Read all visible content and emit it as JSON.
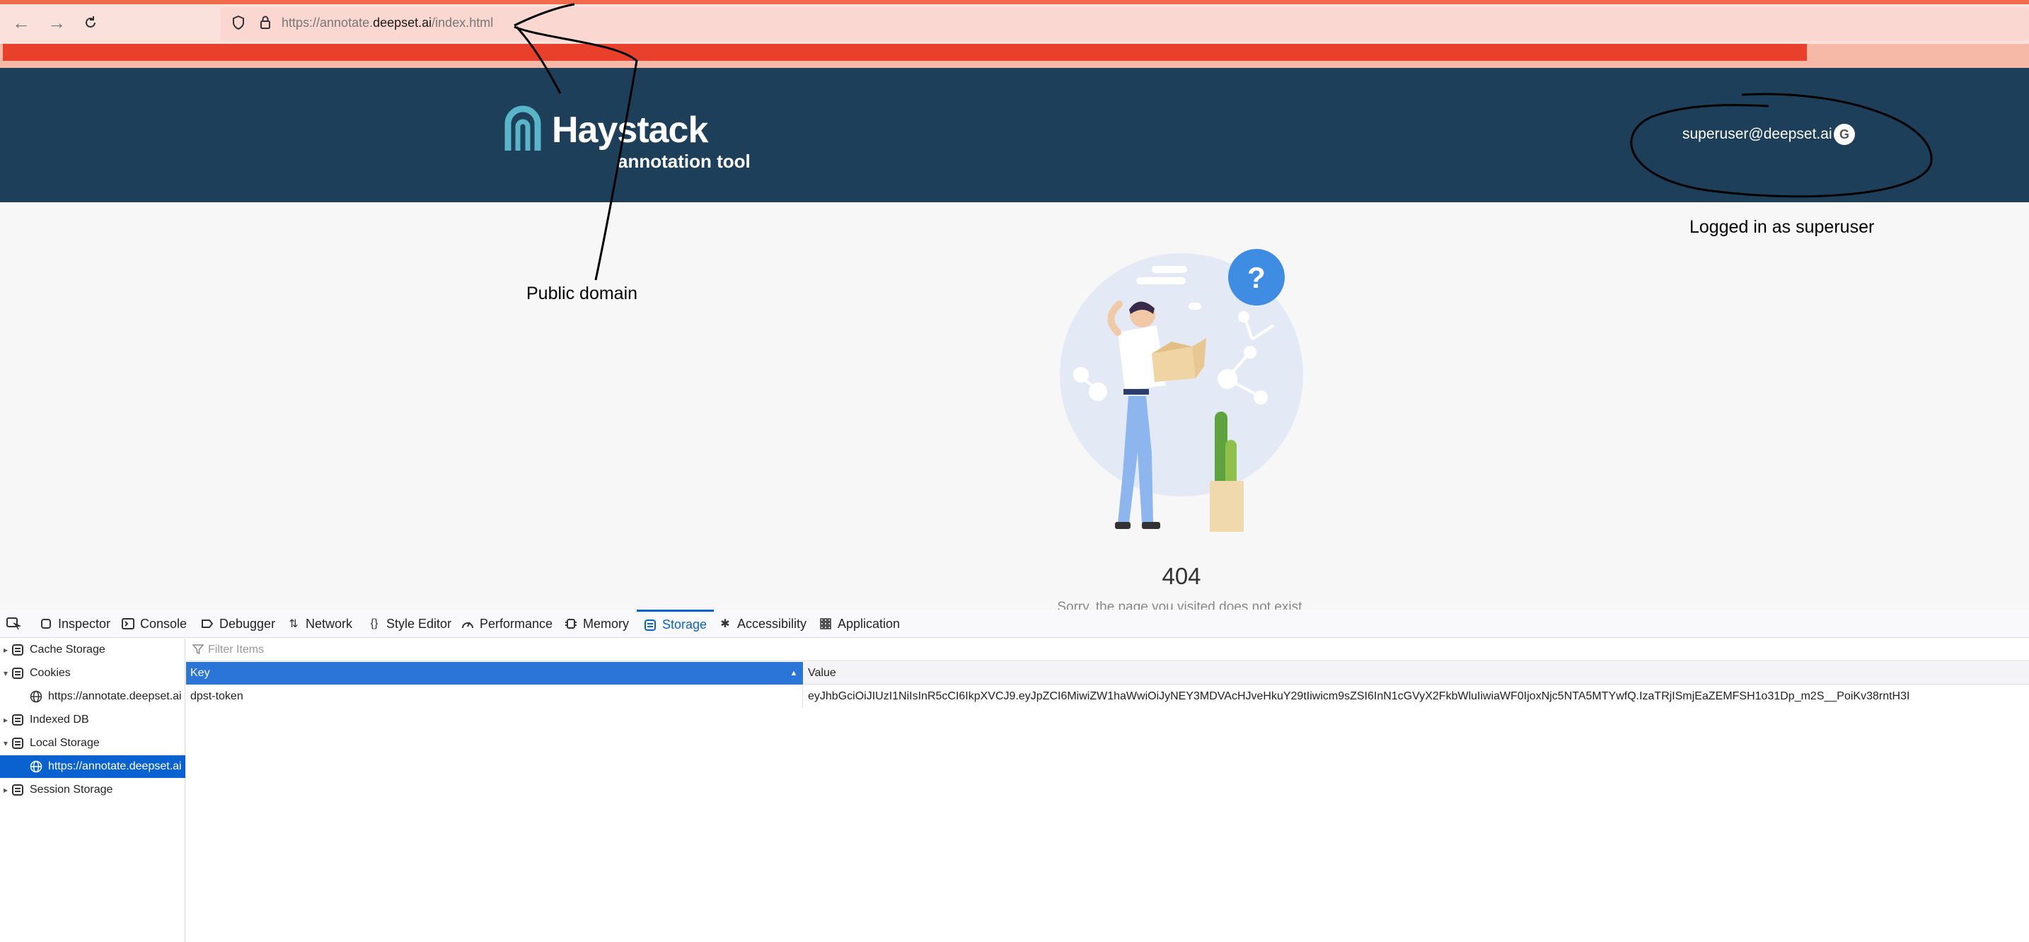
{
  "browser": {
    "url_prefix": "https://annotate.",
    "url_domain": "deepset.ai",
    "url_path": "/index.html"
  },
  "app": {
    "logo_title": "Haystack",
    "logo_subtitle": "annotation tool",
    "user_email": "superuser@deepset.ai",
    "google_icon_letter": "G",
    "brand_color": "#1d3f5a"
  },
  "content": {
    "error_code": "404",
    "error_message": "Sorry, the page you visited does not exist."
  },
  "annotations": {
    "public_domain": "Public domain",
    "logged_in": "Logged in as superuser"
  },
  "devtools": {
    "tabs": [
      {
        "label": "Inspector",
        "icon": "inspector-icon"
      },
      {
        "label": "Console",
        "icon": "console-icon"
      },
      {
        "label": "Debugger",
        "icon": "debugger-icon"
      },
      {
        "label": "Network",
        "icon": "network-icon"
      },
      {
        "label": "Style Editor",
        "icon": "style-editor-icon"
      },
      {
        "label": "Performance",
        "icon": "performance-icon"
      },
      {
        "label": "Memory",
        "icon": "memory-icon"
      },
      {
        "label": "Storage",
        "icon": "storage-icon",
        "active": true
      },
      {
        "label": "Accessibility",
        "icon": "accessibility-icon"
      },
      {
        "label": "Application",
        "icon": "application-icon"
      }
    ],
    "tree": [
      {
        "label": "Cache Storage",
        "expanded": false
      },
      {
        "label": "Cookies",
        "expanded": true
      },
      {
        "label": "https://annotate.deepset.ai",
        "child": true
      },
      {
        "label": "Indexed DB",
        "expanded": false
      },
      {
        "label": "Local Storage",
        "expanded": true
      },
      {
        "label": "https://annotate.deepset.ai",
        "child": true,
        "selected": true
      },
      {
        "label": "Session Storage",
        "expanded": false
      }
    ],
    "filter_placeholder": "Filter Items",
    "table": {
      "columns": [
        "Key",
        "Value"
      ],
      "rows": [
        {
          "key": "dpst-token",
          "value": "eyJhbGciOiJIUzI1NiIsInR5cCI6IkpXVCJ9.eyJpZCI6MiwiZW1haWwiOiJyNEY3MDVAcHJveHkuY29tIiwicm9sZSI6InN1cGVyX2FkbWluIiwiaWF0IjoxNjc5NTA5MTYwfQ.IzaTRjISmjEaZEMFSH1o31Dp_m2S__PoiKv38rntH3I"
        }
      ]
    },
    "accent_color": "#0a62d0"
  }
}
